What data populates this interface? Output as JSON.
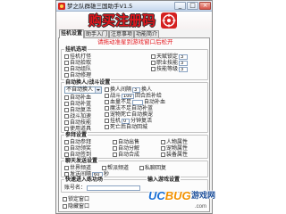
{
  "window": {
    "title": "梦之队群雄三国助手V1.5",
    "minimize": "_",
    "maximize": "□",
    "close": "×"
  },
  "banner": {
    "text": "购买注册码"
  },
  "tabs": [
    {
      "label": "挂机设置",
      "active": true
    },
    {
      "label": "助手入门",
      "active": false
    },
    {
      "label": "注意事项",
      "active": false
    },
    {
      "label": "功能简介",
      "active": false
    }
  ],
  "hint": "请拖动准星到游戏窗口后松开",
  "hook": {
    "title": "挂机选项",
    "left": [
      "挂机打怪",
      "自动拾取",
      "自动组队",
      "自动修理"
    ],
    "right": [
      {
        "label": "天赋锁定",
        "value": "3"
      },
      {
        "label": "职业技能",
        "value": "3"
      },
      {
        "label": "技能等级",
        "value": "3"
      }
    ]
  },
  "battle": {
    "title": "自动换人/战斗设置",
    "mode": "不自动换人",
    "left": [
      "自动补血",
      "自动补蓝",
      "自动复活",
      "战斗加速",
      "自动技能",
      "使用道具"
    ],
    "right": [
      {
        "label": "换人间隔",
        "value": "3",
        "suffix": "换人"
      },
      {
        "label": "战斗",
        "value": "100",
        "suffix": "回合后补给"
      },
      {
        "label": "血量不足",
        "value": "",
        "suffix": "自动补血"
      },
      {
        "label": "魔法不足自动补蓝"
      },
      {
        "label": "宠物死亡自动换宠"
      },
      {
        "label": "挂机",
        "value": "0",
        "suffix": "分钟复活"
      },
      {
        "label": "死亡后自动回城"
      }
    ]
  },
  "worship": {
    "title": "参拜设置",
    "columns": [
      [
        "自动参拜",
        "自动领奖",
        "自动签到"
      ],
      [
        "自动出售",
        "自动分解",
        "自动合成"
      ],
      [
        "人物属性",
        "宠物属性",
        "装备属性"
      ]
    ]
  },
  "chat": {
    "title": "聊天发送设置",
    "options": [
      "世界频道",
      "帮派频道",
      "私聊回复"
    ],
    "interval_label": "发送间隔",
    "interval_value": "60",
    "interval_unit": "秒"
  },
  "quick_enter": {
    "title": "快速进入练功场",
    "side_title": "输入游戏设置",
    "account_label": "账号名：",
    "account_value": ""
  },
  "footer": {
    "options": [
      "锁定窗口",
      "隐藏窗口"
    ]
  },
  "watermark": {
    "uc": "UC",
    "bug": "BUG",
    "site": "游戏网",
    "domain": ".com"
  },
  "colors": {
    "accent_red": "#e3161d",
    "titlebar": "#c7d8ee",
    "watermark_blue": "#1a6fd4",
    "watermark_orange": "#f29100"
  }
}
